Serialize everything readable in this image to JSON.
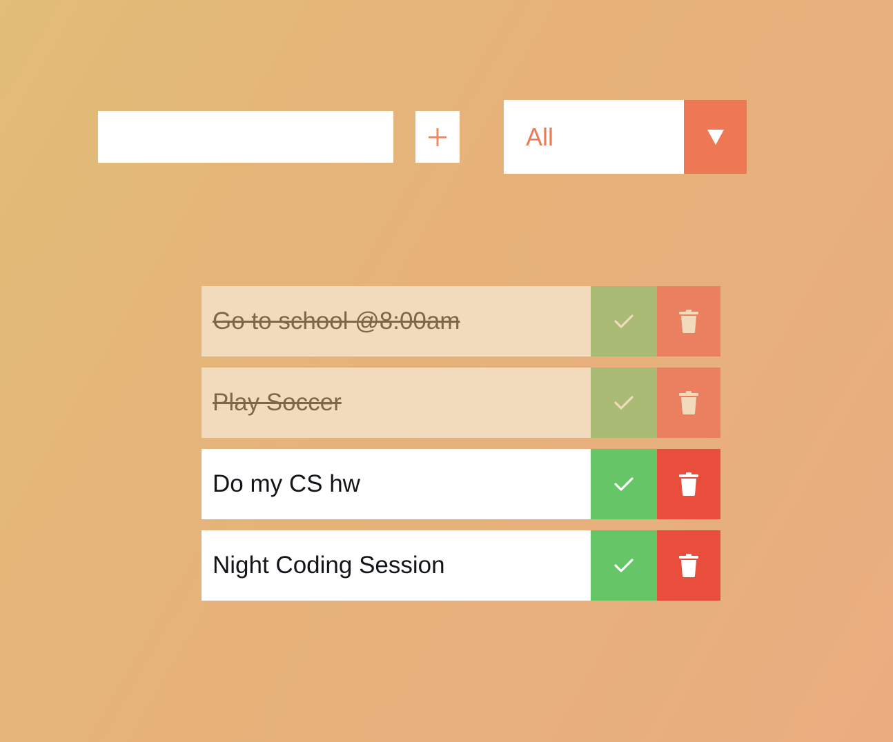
{
  "form": {
    "input": {
      "value": "",
      "placeholder": ""
    },
    "add_button": {
      "icon": "plus-icon"
    },
    "filter": {
      "selected": "All",
      "icon": "triangle-down-icon"
    }
  },
  "todos": [
    {
      "text": "Go to school @8:00am",
      "completed": true
    },
    {
      "text": "Play Soccer",
      "completed": true
    },
    {
      "text": "Do my CS hw",
      "completed": false
    },
    {
      "text": "Night Coding Session",
      "completed": false
    }
  ],
  "colors": {
    "background_start": "#e1bd78",
    "background_end": "#eaad80",
    "accent": "#ee7853",
    "complete": "#66c566",
    "complete_done": "#a9bb75",
    "trash": "#e84e3b",
    "trash_done": "#ea8060",
    "completed_row": "#f2dabd",
    "completed_text": "#7e6749"
  }
}
